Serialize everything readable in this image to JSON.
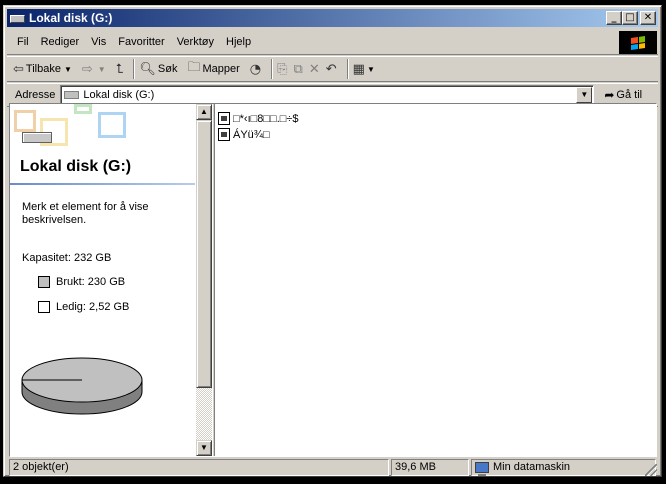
{
  "window": {
    "title": "Lokal disk (G:)"
  },
  "titlebar_buttons": {
    "minimize": "_",
    "maximize": "□",
    "close": "✕"
  },
  "menu": [
    "Fil",
    "Rediger",
    "Vis",
    "Favoritter",
    "Verktøy",
    "Hjelp"
  ],
  "toolbar": {
    "back_label": "Tilbake",
    "search_label": "Søk",
    "folders_label": "Mapper"
  },
  "address": {
    "label": "Adresse",
    "value": "Lokal disk (G:)",
    "go_label": "Gå til"
  },
  "infopane": {
    "title": "Lokal disk (G:)",
    "description": "Merk et element for å vise beskrivelsen.",
    "capacity": "Kapasitet: 232 GB",
    "used": "Brukt: 230 GB",
    "free": "Ledig: 2,52 GB",
    "used_fraction": 0.989,
    "used_color": "#c0c0c0",
    "free_color": "#ffffff"
  },
  "files": [
    {
      "name": "□*‹ı□8□□.□÷$"
    },
    {
      "name": "ÁYü¾□"
    }
  ],
  "status": {
    "objects": "2 objekt(er)",
    "size": "39,6 MB",
    "location": "Min datamaskin"
  }
}
